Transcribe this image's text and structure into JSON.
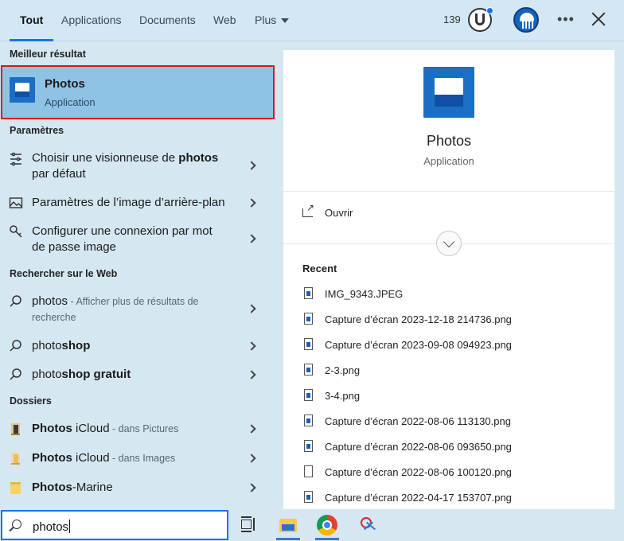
{
  "tabs": [
    {
      "label": "Tout"
    },
    {
      "label": "Applications"
    },
    {
      "label": "Documents"
    },
    {
      "label": "Web"
    },
    {
      "label": "Plus"
    }
  ],
  "header": {
    "points": "139"
  },
  "left": {
    "best_section": "Meilleur résultat",
    "best": {
      "title": "Photos",
      "subtitle": "Application"
    },
    "settings_section": "Paramètres",
    "settings": [
      {
        "pre": "Choisir une visionneuse de ",
        "bold": "photos",
        "post": "",
        "line2": "par défaut"
      },
      {
        "text": "Paramètres de l’image d’arrière-plan"
      },
      {
        "line1": "Configurer une connexion par mot",
        "line2": "de passe image"
      }
    ],
    "web_section": "Rechercher sur le Web",
    "web": [
      {
        "query": "photos",
        "muted": " - Afficher plus de résultats de",
        "muted2": "recherche"
      },
      {
        "pre": "photo",
        "post": "shop"
      },
      {
        "pre": "photo",
        "post": "shop gratuit"
      }
    ],
    "folders_section": "Dossiers",
    "folders": [
      {
        "bold": "Photos",
        "rest": " iCloud",
        "muted": " - dans Pictures"
      },
      {
        "bold": "Photos",
        "rest": " iCloud",
        "muted": " - dans Images"
      },
      {
        "bold": "Photos",
        "rest": "-Marine"
      }
    ]
  },
  "right": {
    "title": "Photos",
    "subtitle": "Application",
    "open_label": "Ouvrir",
    "recent_label": "Recent",
    "files": [
      {
        "name": "IMG_9343.JPEG",
        "kind": "img"
      },
      {
        "name": "Capture d’écran 2023-12-18 214736.png",
        "kind": "img"
      },
      {
        "name": "Capture d’écran 2023-09-08 094923.png",
        "kind": "img"
      },
      {
        "name": "2-3.png",
        "kind": "img"
      },
      {
        "name": "3-4.png",
        "kind": "img"
      },
      {
        "name": "Capture d’écran 2022-08-06 113130.png",
        "kind": "img"
      },
      {
        "name": "Capture d’écran 2022-08-06 093650.png",
        "kind": "img"
      },
      {
        "name": "Capture d’écran 2022-08-06 100120.png",
        "kind": "blank"
      },
      {
        "name": "Capture d’écran 2022-04-17 153707.png",
        "kind": "img"
      }
    ]
  },
  "search": {
    "value": "photos"
  },
  "colors": {
    "accent": "#1a73e8",
    "highlight": "#8fc3e6",
    "selection_border": "#e0141e"
  }
}
